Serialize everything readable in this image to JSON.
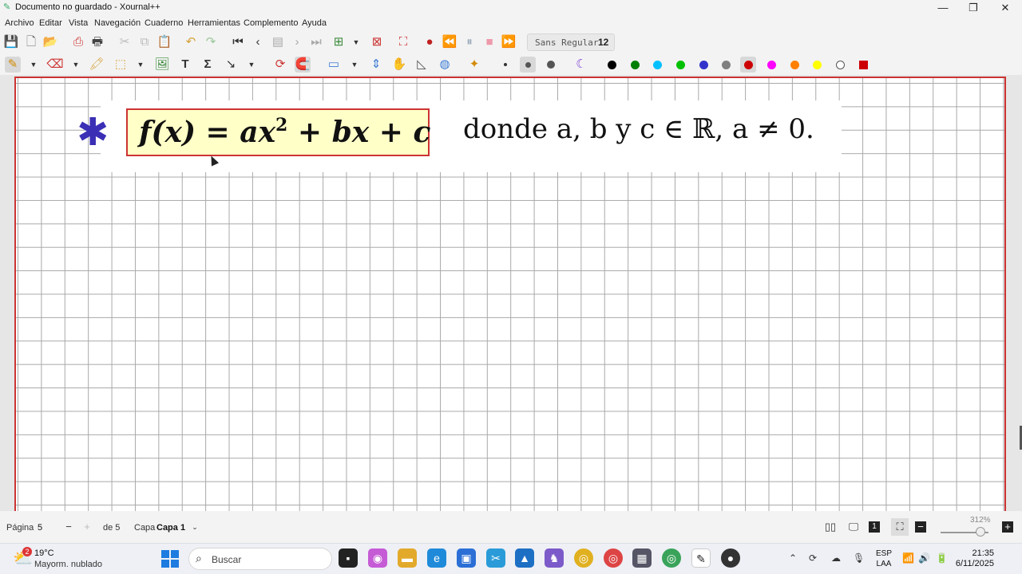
{
  "window": {
    "title": "Documento no guardado - Xournal++",
    "minimize": "—",
    "maximize": "❐",
    "close": "✕"
  },
  "menu": [
    "Archivo",
    "Editar",
    "Vista",
    "Navegación",
    "Cuaderno",
    "Herramientas",
    "Complemento",
    "Ayuda"
  ],
  "font_selector": {
    "name": "Sans Regular",
    "size": "12"
  },
  "canvas": {
    "star": "✱",
    "formula_parts": {
      "lhs": "f(x) = ax",
      "exp": "2",
      "rhs": " + bx + c"
    },
    "condition": "donde a, b y c ∈ ℝ,  a ≠ 0."
  },
  "pen_colors": [
    "#000000",
    "#008000",
    "#00c0ff",
    "#00c000",
    "#3333cc",
    "#808080",
    "#cc0000",
    "#ff00ff",
    "#ff8000",
    "#ffff00",
    "#ffffff",
    "#cc0000"
  ],
  "statusbar": {
    "page_label": "Página",
    "page_value": "5",
    "page_total": "de 5",
    "layer_label": "Capa",
    "layer_value": "Capa 1",
    "zoom": "312%"
  },
  "taskbar": {
    "weather_badge": "2",
    "temperature": "19°C",
    "weather_desc": "Mayorm. nublado",
    "search_placeholder": "Buscar",
    "lang_top": "ESP",
    "lang_bottom": "LAA",
    "time": "21:35",
    "date": "6/11/2025"
  }
}
